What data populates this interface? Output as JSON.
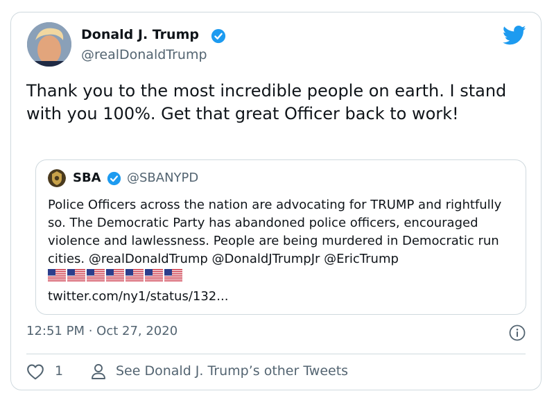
{
  "author": {
    "display_name": "Donald J. Trump",
    "handle": "@realDonaldTrump",
    "verified": true
  },
  "tweet": {
    "text": "Thank you to the most incredible people on earth. I stand with you 100%. Get that great Officer back to work!",
    "timestamp": "12:51 PM · Oct 27, 2020"
  },
  "quoted_tweet": {
    "display_name": "SBA",
    "handle": "@SBANYPD",
    "verified": true,
    "text_part1": "Police Officers across the nation are advocating for TRUMP and rightfully so. The Democratic Party has abandoned police officers, encouraged violence and lawlessness. People are being murdered in Democratic run cities. @realDonaldTrump @DonaldJTrumpJr @EricTrump ",
    "flag_count": 7,
    "link": "twitter.com/ny1/status/132..."
  },
  "actions": {
    "like_count": "1",
    "see_other_label": "See Donald J. Trump’s other Tweets"
  },
  "colors": {
    "verified_blue": "#1d9bf0",
    "secondary_text": "#536471",
    "border": "#cfd9de",
    "twitter_blue": "#1d9bf0"
  },
  "icons": [
    "twitter-bird-icon",
    "verified-badge-icon",
    "info-icon",
    "heart-icon",
    "person-icon",
    "us-flag-icon"
  ]
}
